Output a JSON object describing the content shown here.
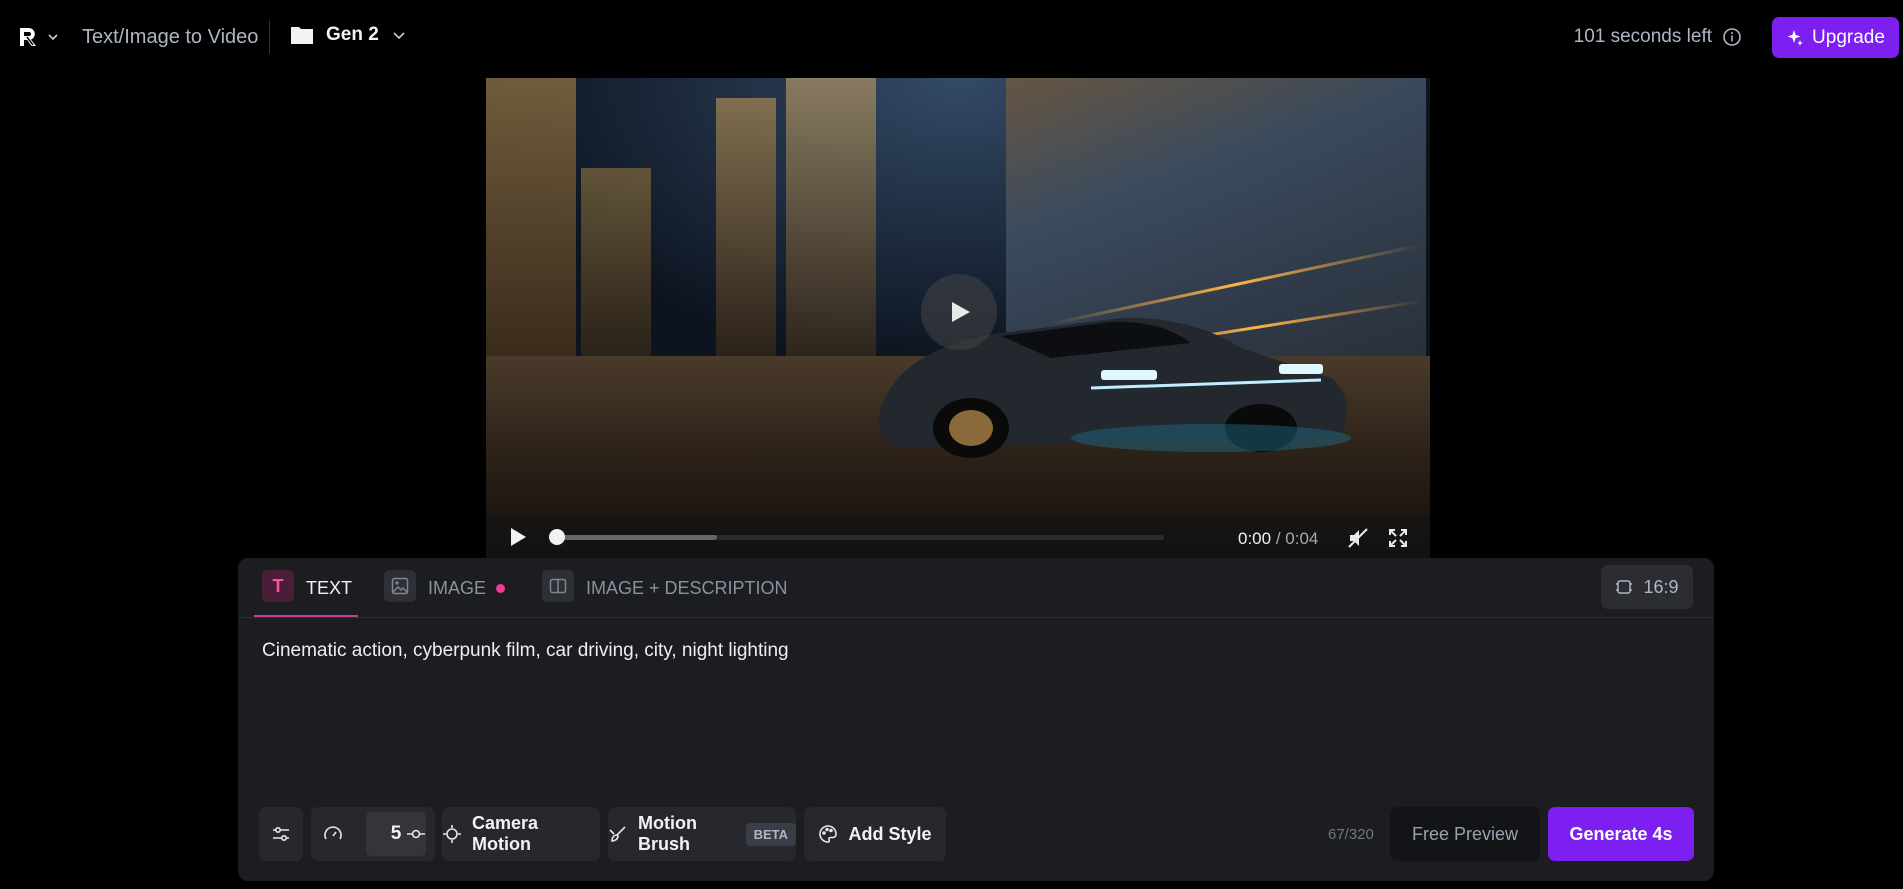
{
  "topbar": {
    "tool_name": "Text/Image to Video",
    "project_name": "Gen 2",
    "seconds_left": "101 seconds left",
    "upgrade_label": "Upgrade"
  },
  "video": {
    "current_time": "0:00",
    "separator": "/",
    "duration": "0:04",
    "progress": 0,
    "buffered": 0.27
  },
  "panel": {
    "tabs": [
      {
        "label": "TEXT",
        "active": true
      },
      {
        "label": "IMAGE",
        "active": false,
        "has_dot": true
      },
      {
        "label": "IMAGE + DESCRIPTION",
        "active": false
      }
    ],
    "aspect_ratio": "16:9",
    "prompt": "Cinematic action, cyberpunk film, car driving, city, night lighting",
    "motion_value": "5",
    "camera_motion_label": "Camera Motion",
    "motion_brush_label": "Motion Brush",
    "beta_label": "BETA",
    "add_style_label": "Add Style",
    "char_count": "67/320",
    "free_preview_label": "Free Preview",
    "generate_label": "Generate 4s"
  },
  "colors": {
    "accent": "#7c1ff0",
    "tab_highlight": "#d43a8c",
    "background": "#000000",
    "panel": "#1c1d21"
  }
}
